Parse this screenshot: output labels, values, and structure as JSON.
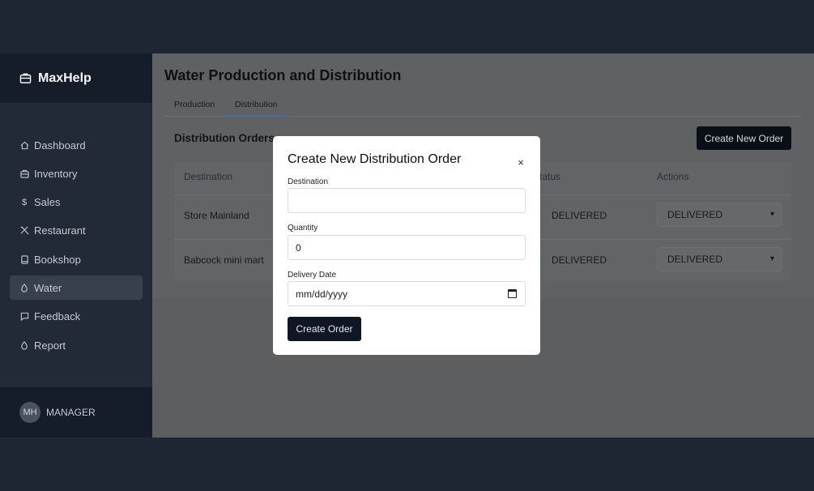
{
  "app": {
    "name": "MaxHelp"
  },
  "sidebar": {
    "items": [
      {
        "label": "Dashboard",
        "icon": "home-icon"
      },
      {
        "label": "Inventory",
        "icon": "briefcase-icon"
      },
      {
        "label": "Sales",
        "icon": "dollar-icon"
      },
      {
        "label": "Restaurant",
        "icon": "utensils-icon"
      },
      {
        "label": "Bookshop",
        "icon": "book-icon"
      },
      {
        "label": "Water",
        "icon": "droplet-icon",
        "active": true
      },
      {
        "label": "Feedback",
        "icon": "message-icon"
      },
      {
        "label": "Report",
        "icon": "droplet-icon"
      }
    ]
  },
  "user": {
    "initials": "MH",
    "role": "MANAGER"
  },
  "page": {
    "title": "Water Production and Distribution",
    "tabs": [
      {
        "label": "Production"
      },
      {
        "label": "Distribution",
        "active": true
      }
    ],
    "section_title": "Distribution Orders",
    "create_new_order_label": "Create New Order"
  },
  "table": {
    "columns": [
      "Destination",
      "tatus",
      "Actions"
    ],
    "rows": [
      {
        "destination": "Store Mainland",
        "status": "DELIVERED",
        "action": "DELIVERED"
      },
      {
        "destination": "Babcock mini mart",
        "status": "DELIVERED",
        "action": "DELIVERED"
      }
    ]
  },
  "modal": {
    "title": "Create New Distribution Order",
    "close_symbol": "×",
    "destination_label": "Destination",
    "destination_value": "",
    "quantity_label": "Quantity",
    "quantity_value": "0",
    "delivery_date_label": "Delivery Date",
    "delivery_date_placeholder": "mm/dd/yyyy",
    "submit_label": "Create Order"
  },
  "colors": {
    "sidebar_bg": "#222a37",
    "accent": "#0f1624",
    "status_delivered": "#2f7a3c"
  }
}
